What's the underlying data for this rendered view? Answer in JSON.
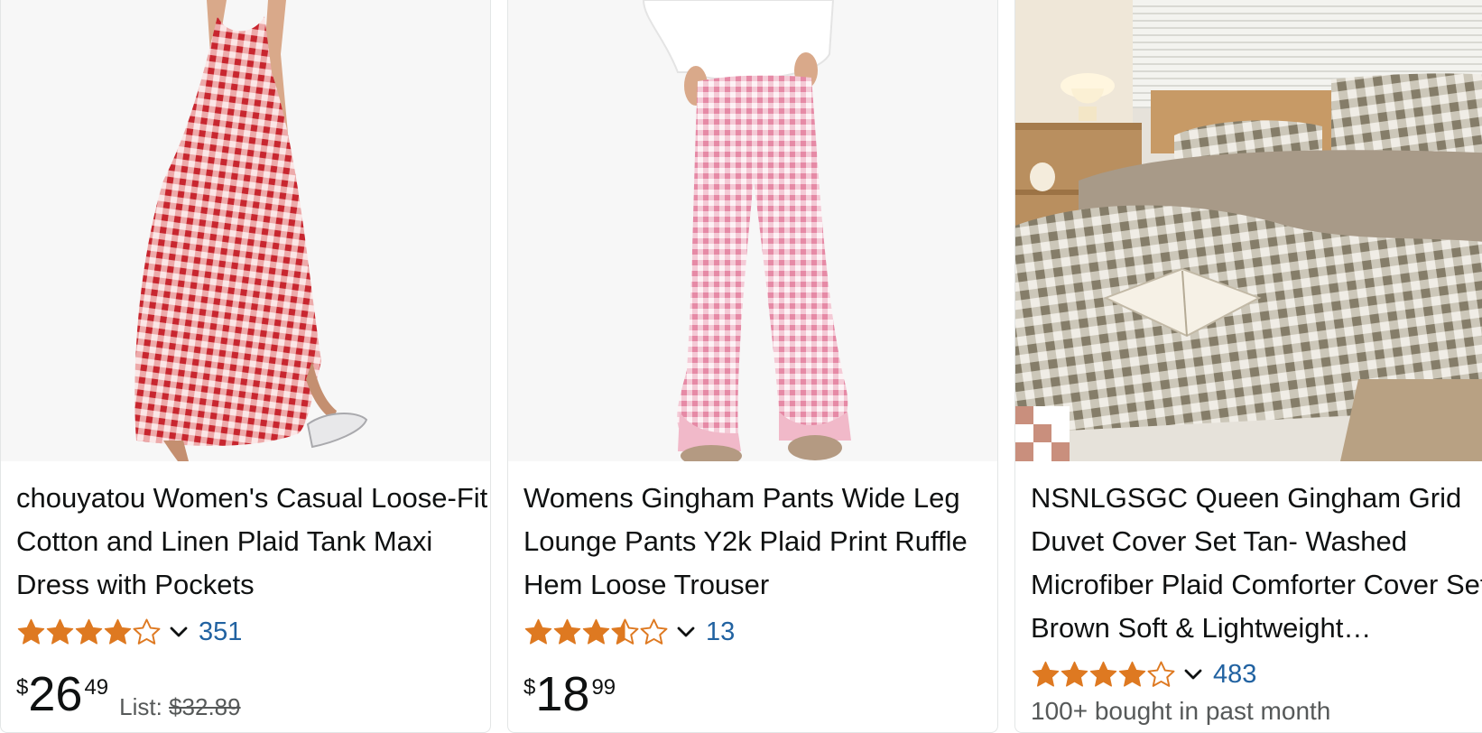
{
  "products": [
    {
      "title": "chouyatou Women's Casual Loose-Fit Cotton and Linen Plaid Tank Maxi Dress with Pockets",
      "rating": 4.0,
      "review_count": "351",
      "price_symbol": "$",
      "price_whole": "26",
      "price_fraction": "49",
      "list_label": "List:",
      "list_price": "$32.89"
    },
    {
      "title": "Womens Gingham Pants Wide Leg Lounge Pants Y2k Plaid Print Ruffle Hem Loose Trouser",
      "rating": 3.5,
      "review_count": "13",
      "price_symbol": "$",
      "price_whole": "18",
      "price_fraction": "99"
    },
    {
      "title": "NSNLGSGC Queen Gingham Grid Duvet Cover Set Tan- Washed Microfiber Plaid Comforter Cover Set Brown Soft & Lightweight…",
      "rating": 4.0,
      "review_count": "483",
      "bought_text": "100+ bought in past month"
    }
  ],
  "icons": {
    "star_filled": "star-filled-icon",
    "star_half": "star-half-icon",
    "star_empty": "star-empty-icon",
    "chevron": "chevron-down-icon"
  },
  "colors": {
    "star": "#de7921",
    "link": "#2162a1",
    "text": "#0f1111",
    "secondary": "#565959"
  }
}
